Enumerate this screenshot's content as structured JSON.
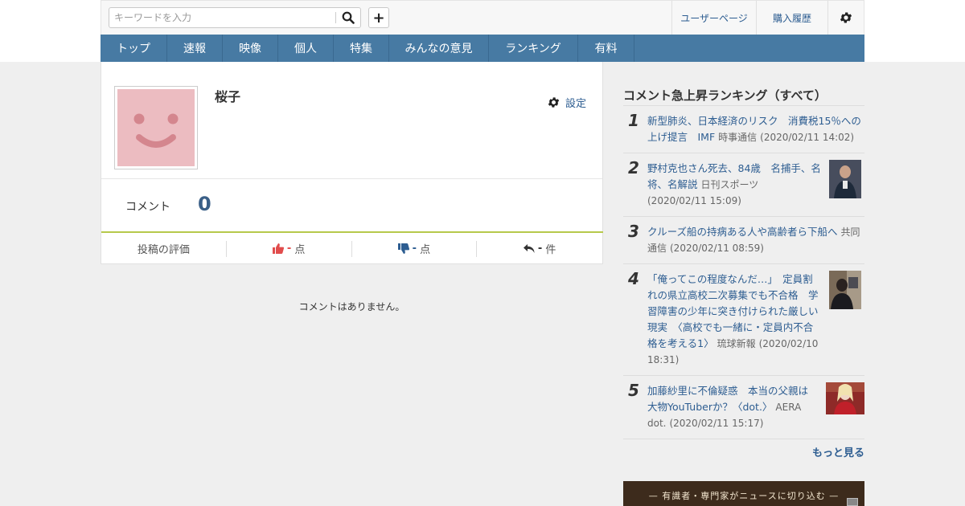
{
  "search": {
    "placeholder": "キーワードを入力"
  },
  "header_links": {
    "user_page": "ユーザーページ",
    "purchase_history": "購入履歴"
  },
  "nav": {
    "items": [
      "トップ",
      "速報",
      "映像",
      "個人",
      "特集",
      "みんなの意見",
      "ランキング",
      "有料"
    ]
  },
  "profile": {
    "name": "桜子",
    "settings_label": "設定",
    "comment_label": "コメント",
    "comment_count": "0",
    "stats": {
      "label": "投稿の評価",
      "good_value": "-",
      "good_unit": "点",
      "bad_value": "-",
      "bad_unit": "点",
      "reply_value": "-",
      "reply_unit": "件"
    },
    "empty_message": "コメントはありません。"
  },
  "ranking": {
    "title": "コメント急上昇ランキング（すべて）",
    "items": [
      {
        "rank": "1",
        "title": "新型肺炎、日本経済のリスク　消費税15％への上げ提言　IMF",
        "source": "時事通信",
        "date": "(2020/02/11 14:02)"
      },
      {
        "rank": "2",
        "title": "野村克也さん死去、84歳　名捕手、名将、名解説",
        "source": "日刊スポーツ",
        "date": "(2020/02/11 15:09)"
      },
      {
        "rank": "3",
        "title": "クルーズ船の持病ある人や高齢者ら下船へ",
        "source": "共同通信",
        "date": "(2020/02/11 08:59)"
      },
      {
        "rank": "4",
        "title": "「俺ってこの程度なんだ…」　定員割れの県立高校二次募集でも不合格　学習障害の少年に突き付けられた厳しい現実　〈高校でも一緒に・定員内不合格を考える1〉",
        "source": "琉球新報",
        "date": "(2020/02/10 18:31)"
      },
      {
        "rank": "5",
        "title": "加藤紗里に不倫疑惑　本当の父親は大物YouTuberか？〈dot.〉",
        "source": "AERA dot.",
        "date": "(2020/02/11 15:17)"
      }
    ],
    "more_label": "もっと見る"
  },
  "banner": {
    "text": "— 有識者・専門家がニュースに切り込む —"
  },
  "colors": {
    "nav_bg": "#477aa3",
    "link": "#2d5d91",
    "accent_green": "#b6c94b",
    "avatar_pink": "#ecbcc1"
  }
}
